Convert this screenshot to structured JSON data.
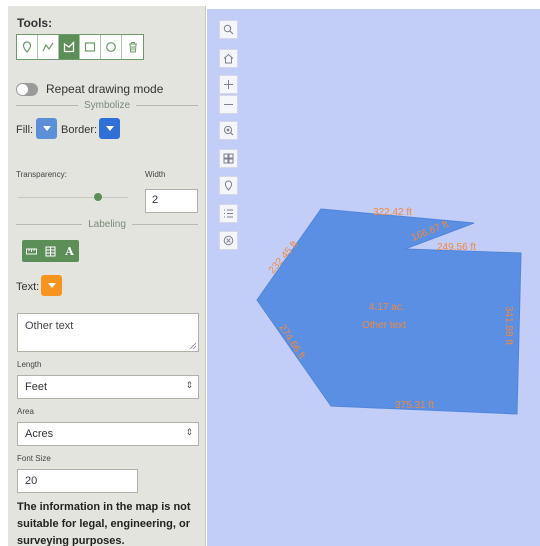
{
  "tools": {
    "title": "Tools:",
    "buttons": [
      {
        "name": "point-tool",
        "icon": "marker-icon",
        "active": false
      },
      {
        "name": "line-tool",
        "icon": "polyline-icon",
        "active": false
      },
      {
        "name": "polygon-tool",
        "icon": "polygon-icon",
        "active": true
      },
      {
        "name": "rectangle-tool",
        "icon": "rectangle-icon",
        "active": false
      },
      {
        "name": "circle-tool",
        "icon": "circle-icon",
        "active": false
      },
      {
        "name": "delete-tool",
        "icon": "trash-icon",
        "active": false
      }
    ],
    "repeat_label": "Repeat drawing mode"
  },
  "symbolize": {
    "heading": "Symbolize",
    "fill_label": "Fill:",
    "border_label": "Border:",
    "fill_color": "#5b8fd8",
    "border_color": "#2f6fd6",
    "transparency_label": "Transparency:",
    "transparency_value": 0.75,
    "width_label": "Width",
    "width_value": "2"
  },
  "labeling": {
    "heading": "Labeling",
    "buttons": [
      {
        "name": "label-length-button",
        "icon": "ruler-icon"
      },
      {
        "name": "label-area-button",
        "icon": "area-icon"
      },
      {
        "name": "label-text-button",
        "icon": "text-a-icon",
        "text": "A"
      }
    ],
    "text_label": "Text:",
    "text_color": "#f7941d",
    "text_value": "Other text",
    "length_label": "Length",
    "length_value": "Feet",
    "area_label": "Area",
    "area_value": "Acres",
    "font_size_label": "Font Size",
    "font_size_value": "20"
  },
  "disclaimer": "The information in the map is not suitable for legal, engineering, or surveying purposes.",
  "map": {
    "buttons": [
      {
        "name": "zoom-search-button",
        "icon": "search-icon"
      },
      {
        "name": "home-button",
        "icon": "home-icon"
      },
      {
        "name": "zoom-in-button",
        "icon": "plus-icon"
      },
      {
        "name": "zoom-out-button",
        "icon": "minus-icon"
      },
      {
        "name": "zoom-extent-button",
        "icon": "zoom-extent-icon"
      },
      {
        "name": "basemap-button",
        "icon": "grid-icon"
      },
      {
        "name": "draw-button",
        "icon": "marker-icon"
      },
      {
        "name": "legend-button",
        "icon": "list-icon"
      },
      {
        "name": "clear-button",
        "icon": "close-circle-icon"
      }
    ],
    "polygon_fill": "#5b8fe3",
    "label_color": "#f18a3b",
    "measurements": {
      "m1": "322.42 ft",
      "m2": "166.67 ft",
      "m3": "249.56 ft",
      "m4": "232.45 ft",
      "m5": "274.66 ft",
      "m6": "341.88 ft",
      "m7": "375.31 ft"
    },
    "area_text": "4.17 ac.",
    "other_text": "Other text"
  }
}
